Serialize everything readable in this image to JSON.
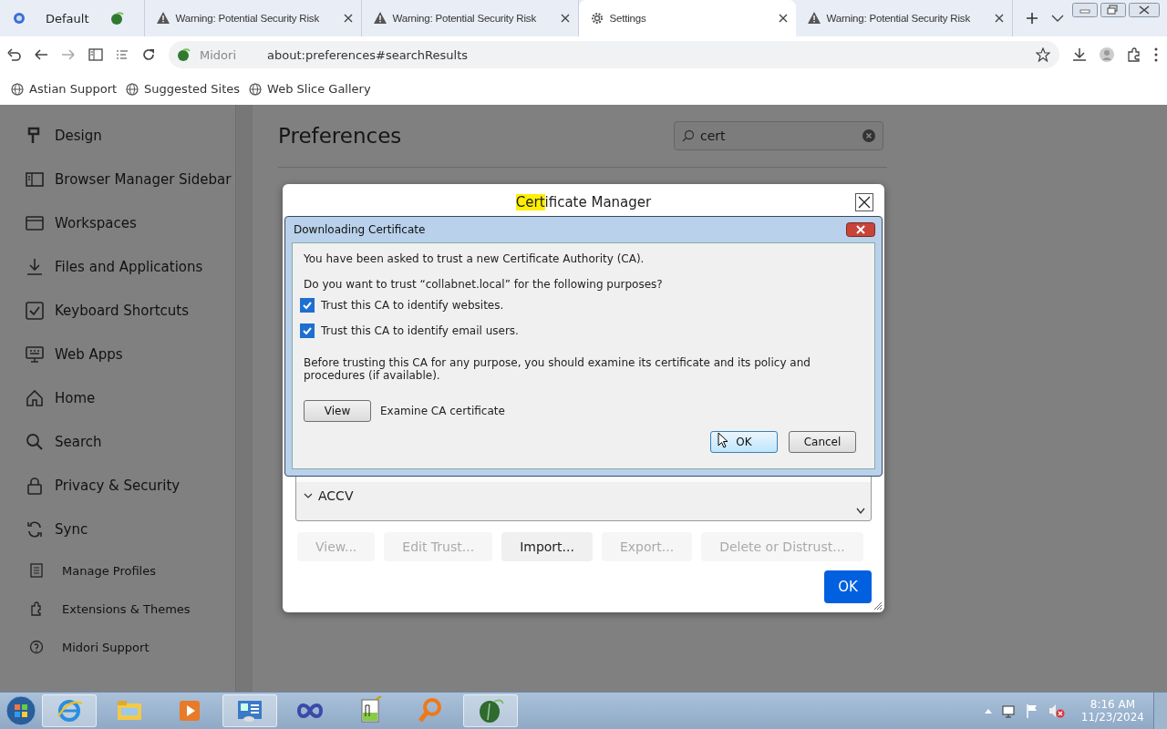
{
  "profile_tab": {
    "label": "Default"
  },
  "tabs": [
    {
      "label": "Warning: Potential Security Risk",
      "kind": "warning",
      "selected": false
    },
    {
      "label": "Warning: Potential Security Risk",
      "kind": "warning",
      "selected": false
    },
    {
      "label": "Settings",
      "kind": "settings",
      "selected": true
    },
    {
      "label": "Warning: Potential Security Risk",
      "kind": "warning",
      "selected": false
    }
  ],
  "address_bar": {
    "site": "Midori",
    "url": "about:preferences#searchResults"
  },
  "bookmarks": [
    "Astian Support",
    "Suggested Sites",
    "Web Slice Gallery"
  ],
  "sidebar": {
    "items": [
      {
        "label": "Design",
        "kind": "large"
      },
      {
        "label": "Browser Manager Sidebar",
        "kind": "large"
      },
      {
        "label": "Workspaces",
        "kind": "large"
      },
      {
        "label": "Files and Applications",
        "kind": "large"
      },
      {
        "label": "Keyboard Shortcuts",
        "kind": "large"
      },
      {
        "label": "Web Apps",
        "kind": "large"
      },
      {
        "label": "Home",
        "kind": "large"
      },
      {
        "label": "Search",
        "kind": "large"
      },
      {
        "label": "Privacy & Security",
        "kind": "large"
      },
      {
        "label": "Sync",
        "kind": "large"
      },
      {
        "label": "Manage Profiles",
        "kind": "small"
      },
      {
        "label": "Extensions & Themes",
        "kind": "small"
      },
      {
        "label": "Midori Support",
        "kind": "small"
      }
    ]
  },
  "page": {
    "title": "Preferences",
    "search": {
      "value": "cert"
    }
  },
  "certificate_manager": {
    "title_highlight": "Cert",
    "title_rest": "ificate Manager",
    "tree_rows": [
      {
        "label": "ACCV",
        "expanded": true
      }
    ],
    "buttons": [
      {
        "label": "View...",
        "disabled": true
      },
      {
        "label": "Edit Trust...",
        "disabled": true
      },
      {
        "label": "Import...",
        "disabled": false
      },
      {
        "label": "Export...",
        "disabled": true
      },
      {
        "label": "Delete or Distrust...",
        "disabled": true
      }
    ],
    "ok": "OK"
  },
  "download_dialog": {
    "title": "Downloading Certificate",
    "intro": "You have been asked to trust a new Certificate Authority (CA).",
    "question": "Do you want to trust “collabnet.local” for the following purposes?",
    "options": [
      {
        "label": "Trust this CA to identify websites.",
        "checked": true
      },
      {
        "label": "Trust this CA to identify email users.",
        "checked": true
      }
    ],
    "advice": "Before trusting this CA for any purpose, you should examine its certificate and its policy and procedures (if available).",
    "view_button": "View",
    "view_label": "Examine CA certificate",
    "buttons": [
      {
        "label": "OK",
        "kind": "default"
      },
      {
        "label": "Cancel",
        "kind": "normal"
      }
    ]
  },
  "taskbar": {
    "time": "8:16 AM",
    "date": "11/23/2024"
  }
}
